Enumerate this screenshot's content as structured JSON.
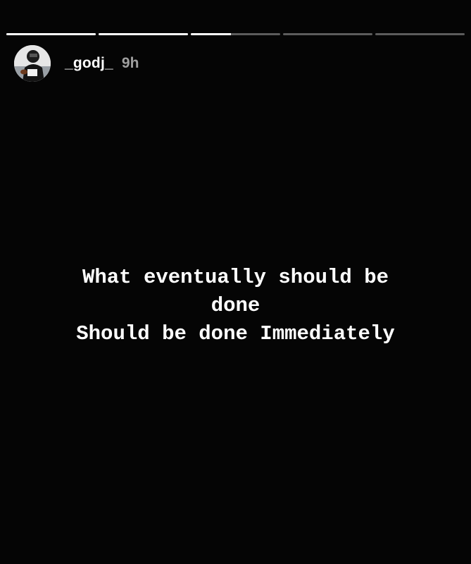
{
  "story": {
    "progress_segments": [
      {
        "progress": 1.0
      },
      {
        "progress": 1.0
      },
      {
        "progress": 0.45
      },
      {
        "progress": 0.0
      },
      {
        "progress": 0.0
      }
    ],
    "user": {
      "username": "_godj_",
      "time_ago": "9h",
      "avatar_icon": "user-avatar-icon"
    },
    "text_lines": [
      "What eventually should be",
      "done",
      "Should be done Immediately"
    ],
    "colors": {
      "background": "#000000",
      "text": "#ffffff",
      "progress_track": "rgba(255,255,255,0.35)",
      "progress_fill": "#ffffff"
    }
  }
}
